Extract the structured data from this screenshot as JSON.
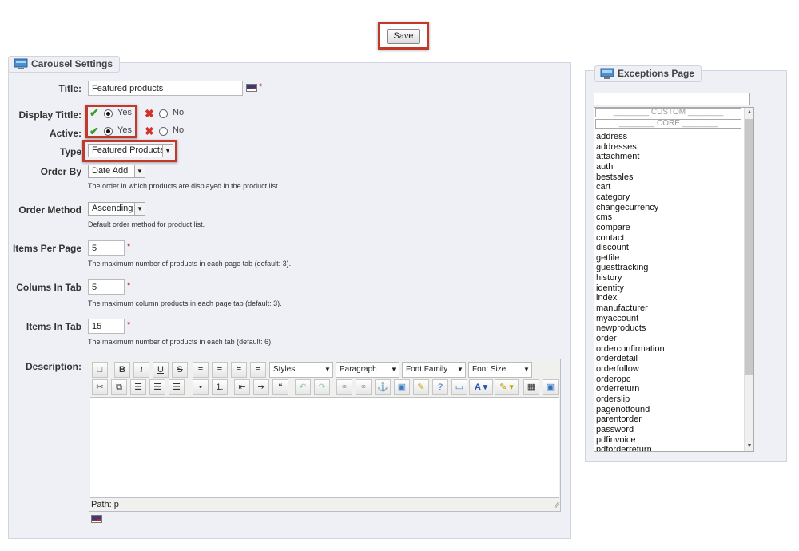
{
  "save_label": "Save",
  "carousel": {
    "legend": "Carousel Settings",
    "title_label": "Title:",
    "title_value": "Featured products",
    "display_title_label": "Display Tittle:",
    "active_label": "Active:",
    "yes": "Yes",
    "no": "No",
    "type_label": "Type",
    "type_value": "Featured Products",
    "order_by_label": "Order By",
    "order_by_value": "Date Add",
    "order_by_hint": "The order in which products are displayed in the product list.",
    "order_method_label": "Order Method",
    "order_method_value": "Ascending",
    "order_method_hint": "Default order method for product list.",
    "items_per_page_label": "Items Per Page",
    "items_per_page_value": "5",
    "items_per_page_hint": "The maximum number of products in each page tab (default: 3).",
    "columns_label": "Colums In Tab",
    "columns_value": "5",
    "columns_hint": "The maximum column products in each page tab (default: 3).",
    "items_in_tab_label": "Items In Tab",
    "items_in_tab_value": "15",
    "items_in_tab_hint": "The maximum number of products in each tab (default: 6).",
    "description_label": "Description:",
    "req": "*"
  },
  "editor": {
    "styles": "Styles",
    "paragraph": "Paragraph",
    "font_family": "Font Family",
    "font_size": "Font Size",
    "path": "Path: p"
  },
  "exceptions": {
    "legend": "Exceptions Page",
    "group_custom": "________ CUSTOM ________",
    "group_core": "________ CORE ________",
    "pages": [
      "address",
      "addresses",
      "attachment",
      "auth",
      "bestsales",
      "cart",
      "category",
      "changecurrency",
      "cms",
      "compare",
      "contact",
      "discount",
      "getfile",
      "guesttracking",
      "history",
      "identity",
      "index",
      "manufacturer",
      "myaccount",
      "newproducts",
      "order",
      "orderconfirmation",
      "orderdetail",
      "orderfollow",
      "orderopc",
      "orderreturn",
      "orderslip",
      "pagenotfound",
      "parentorder",
      "password",
      "pdfinvoice",
      "pdforderreturn"
    ]
  }
}
